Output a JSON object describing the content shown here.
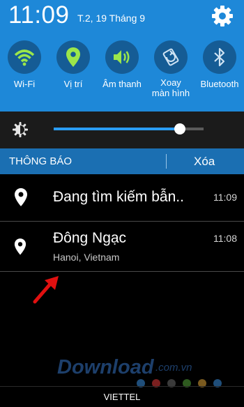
{
  "status": {
    "time": "11:09",
    "date": "T.2, 19 Tháng 9"
  },
  "quick_settings": [
    {
      "label": "Wi-Fi",
      "icon": "wifi-icon"
    },
    {
      "label": "Vị trí",
      "icon": "location-icon"
    },
    {
      "label": "Âm thanh",
      "icon": "volume-icon"
    },
    {
      "label": "Xoay\nmàn hình",
      "icon": "rotate-icon"
    },
    {
      "label": "Bluetooth",
      "icon": "bluetooth-icon"
    }
  ],
  "brightness": {
    "level": 0.84
  },
  "notifications_header": {
    "title": "THÔNG BÁO",
    "clear_label": "Xóa"
  },
  "notifications": [
    {
      "title": "Đang tìm kiếm bẫn..",
      "subtitle": "",
      "time": "11:09",
      "icon": "location-icon"
    },
    {
      "title": "Đông Ngạc",
      "subtitle": "Hanoi, Vietnam",
      "time": "11:08",
      "icon": "location-icon"
    }
  ],
  "watermark": {
    "brand": "Download",
    "domain": ".com.vn"
  },
  "footer": {
    "carrier": "VIETTEL"
  },
  "colors": {
    "panel": "#1e88d8",
    "active_icon": "#9be64b",
    "bar": "#1b6fb2"
  }
}
